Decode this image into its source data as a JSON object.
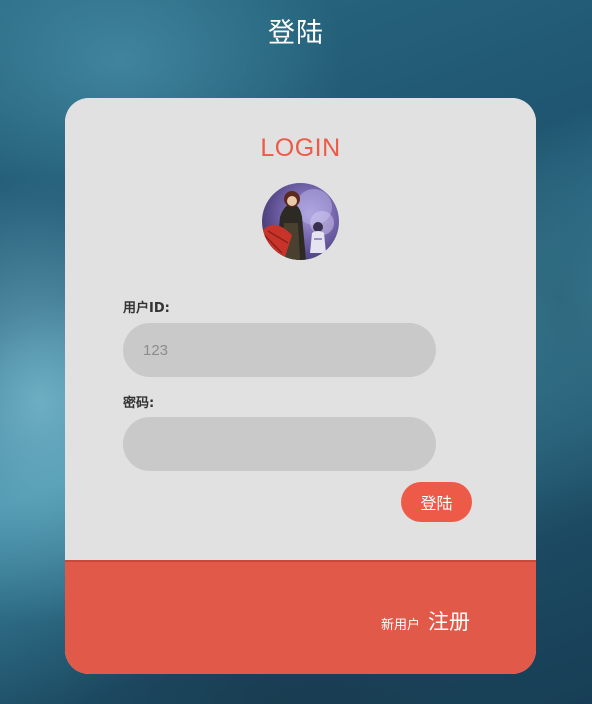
{
  "page": {
    "title": "登陆"
  },
  "card": {
    "heading": "LOGIN",
    "avatar_icon": "user-avatar-illustration",
    "user_field": {
      "label": "用户ID:",
      "value": "",
      "placeholder": "123"
    },
    "password_field": {
      "label": "密码:",
      "value": "",
      "placeholder": ""
    },
    "login_button_label": "登陆",
    "footer": {
      "new_user_text": "新用户",
      "register_link": "注册"
    }
  },
  "colors": {
    "accent": "#ee5a48",
    "footer": "#e15a49",
    "card_bg": "#e1e1e1",
    "input_bg": "#c9c9c9"
  }
}
